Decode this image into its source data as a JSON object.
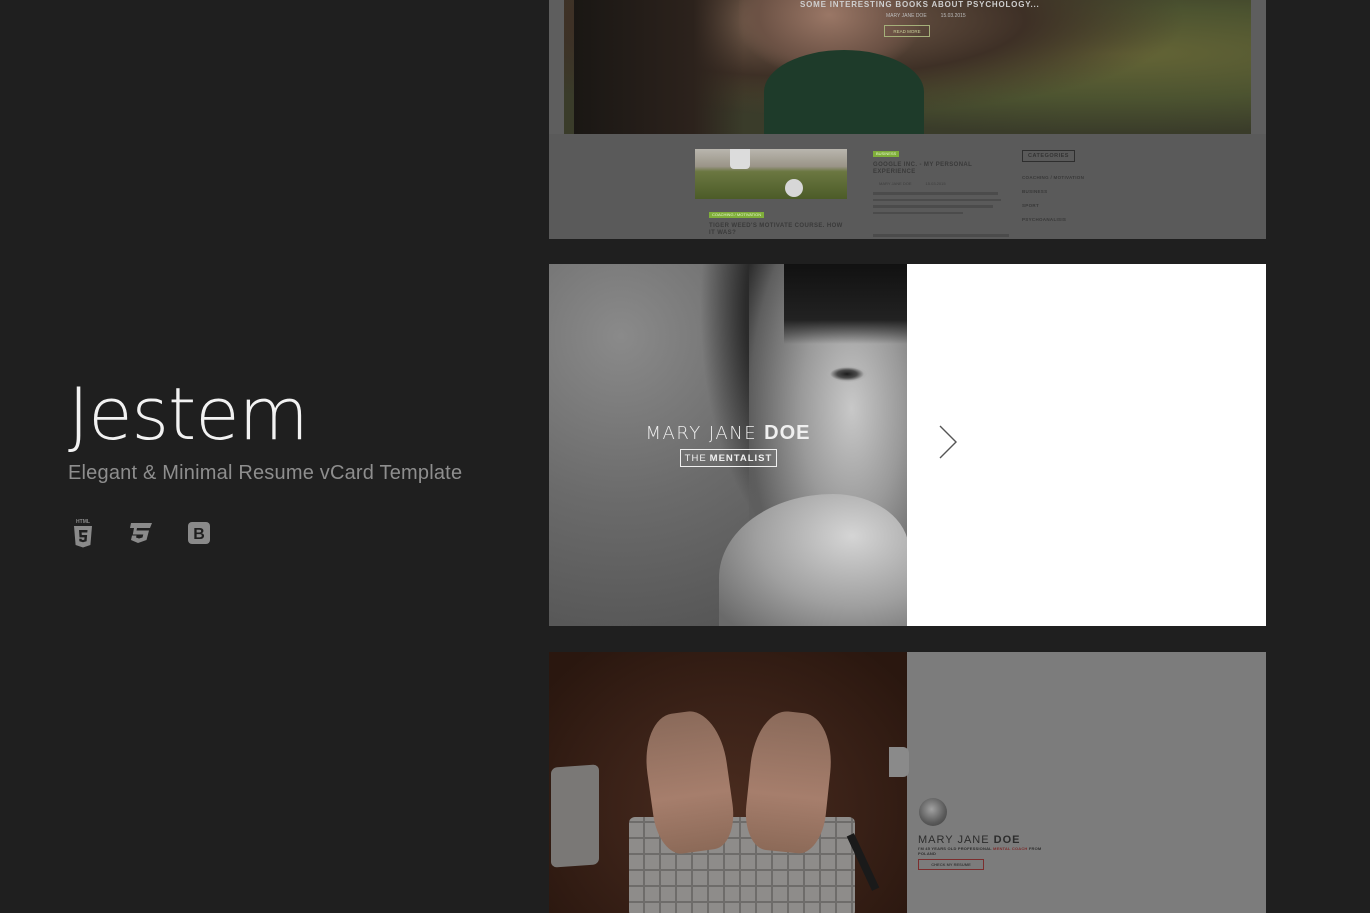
{
  "brand": {
    "title": "Jestem",
    "subtitle": "Elegant & Minimal Resume vCard Template"
  },
  "tech_icons": [
    {
      "name": "html5-icon",
      "label": "HTML"
    },
    {
      "name": "css3-icon"
    },
    {
      "name": "bootstrap-icon",
      "label": "B"
    }
  ],
  "blog_preview": {
    "hero_title": "SOME INTERESTING BOOKS ABOUT PSYCHOLOGY...",
    "hero_author": "MARY JANE DOE",
    "hero_date": "15.03.2015",
    "hero_button": "READ MORE",
    "post1_tag": "BUSINESS",
    "post1_title": "GOOGLE INC. - MY PERSONAL EXPERIENCE",
    "post1_author": "MARY JANE DOE",
    "post1_date": "15.03.2015",
    "post2_tag": "COACHING / MOTIVATION",
    "post2_title": "TIGER WEED'S MOTIVATE COURSE. HOW IT WAS?",
    "categories_title": "CATEGORIES",
    "categories": [
      "COACHING / MOTIVATION",
      "BUSINESS",
      "SPORT",
      "PSYCHOANALISIS"
    ]
  },
  "hero": {
    "first_name": "MARY JANE",
    "last_name": "DOE",
    "role_prefix": "THE",
    "role": "MENTALIST"
  },
  "profile": {
    "first_name": "MARY JANE",
    "last_name": "DOE",
    "desc_prefix": "I'M 45 YEARS OLD PROFESSIONAL",
    "desc_highlight": "MENTAL COACH",
    "desc_suffix": "FROM POLAND",
    "button": "CHECK MY RESUME"
  }
}
